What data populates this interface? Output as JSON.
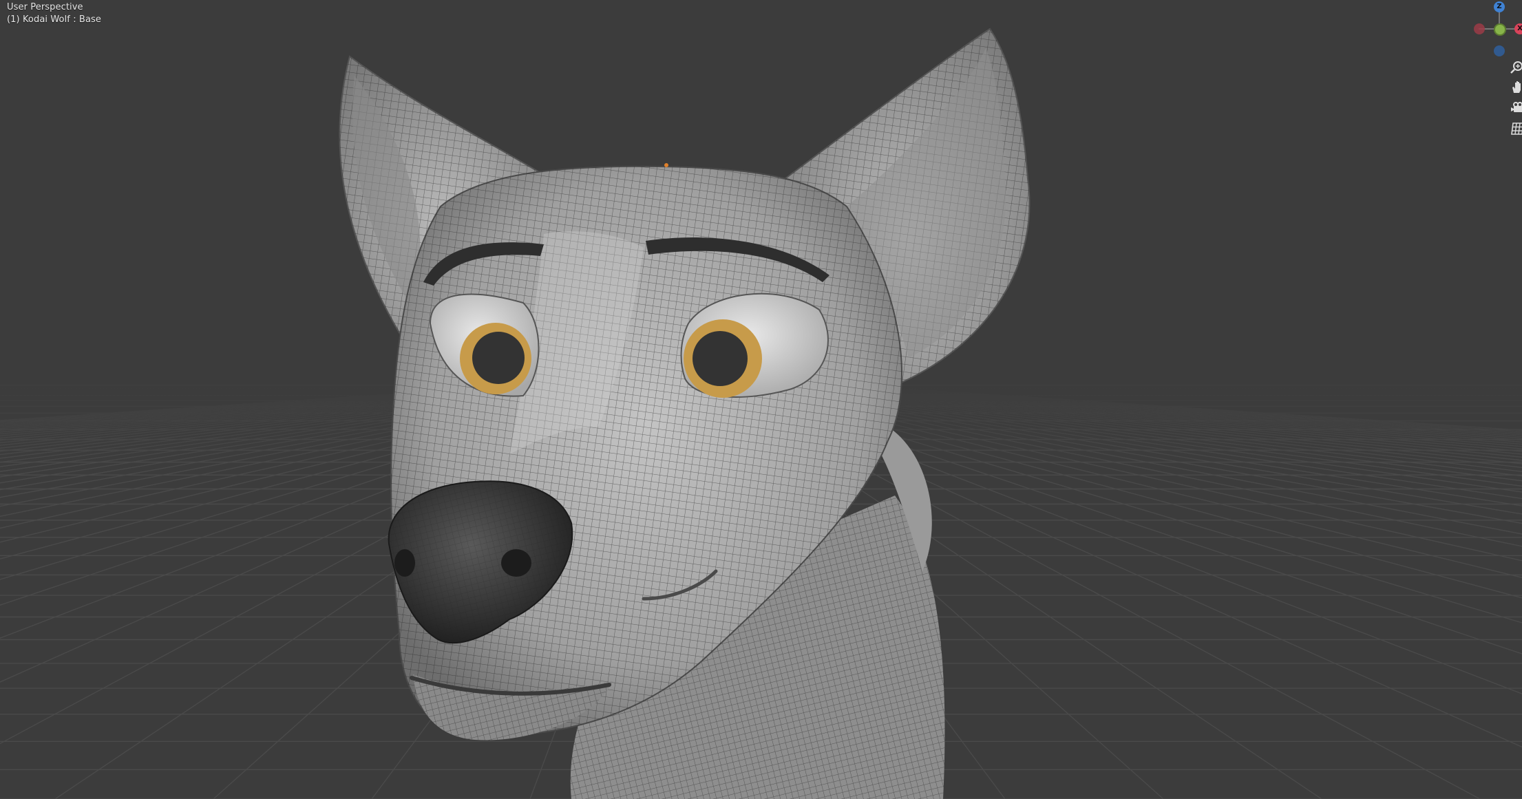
{
  "viewport": {
    "view_name": "User Perspective",
    "object_prefix": "(1)",
    "object_label": "Kodai Wolf : Base"
  },
  "gizmo": {
    "z_label": "Z",
    "x_label": "X",
    "colors": {
      "x": "#d9435a",
      "y": "#88b44a",
      "z": "#3f82d4"
    }
  },
  "nav_tools": {
    "zoom_icon": "zoom-icon",
    "pan_icon": "hand-icon",
    "camera_icon": "camera-icon",
    "grid_icon": "grid-icon"
  },
  "colors": {
    "background": "#3c3c3c",
    "grid_line": "#474747",
    "mesh": "#a9a9a9",
    "iris": "#c79b4a",
    "pupil": "#333333",
    "nose": "#2e2e2e",
    "origin_dot": "#e0812b"
  }
}
